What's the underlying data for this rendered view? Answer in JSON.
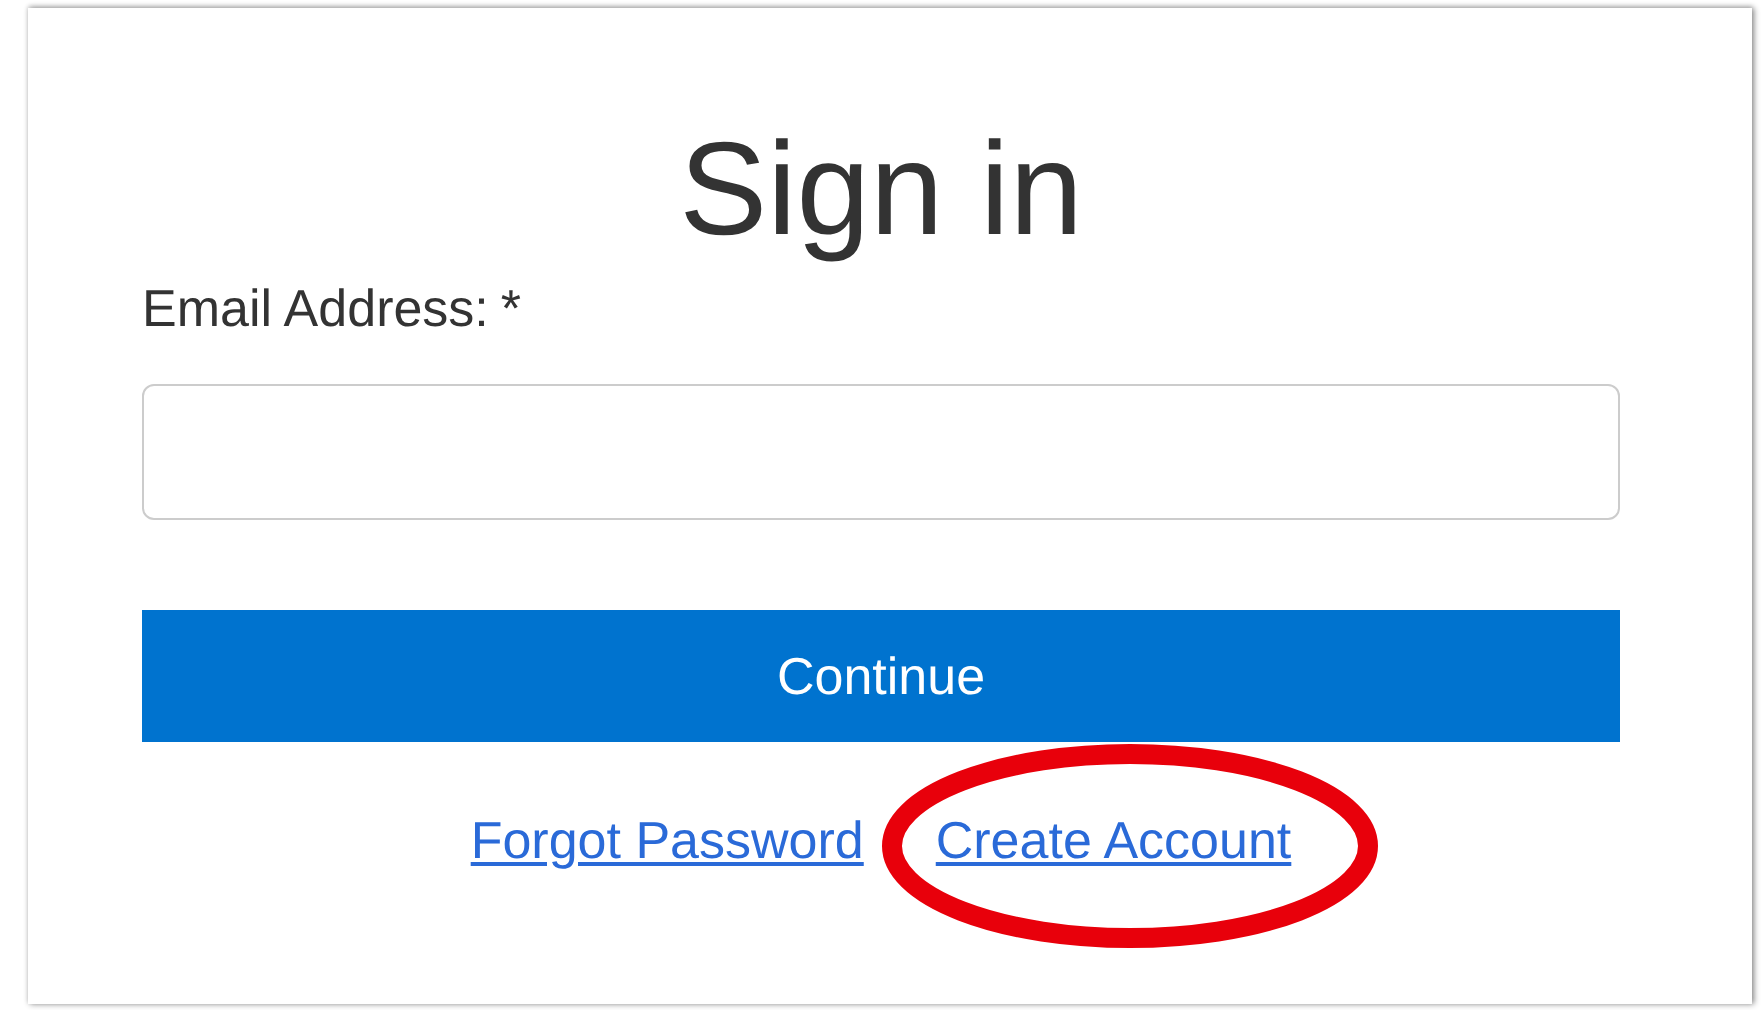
{
  "title": "Sign in",
  "email_field": {
    "label": "Email Address:",
    "required_mark": "*"
  },
  "button": {
    "label": "Continue"
  },
  "links": [
    {
      "label": "Forgot Password",
      "circled": false
    },
    {
      "label": "Create Account",
      "circled": true
    }
  ]
}
